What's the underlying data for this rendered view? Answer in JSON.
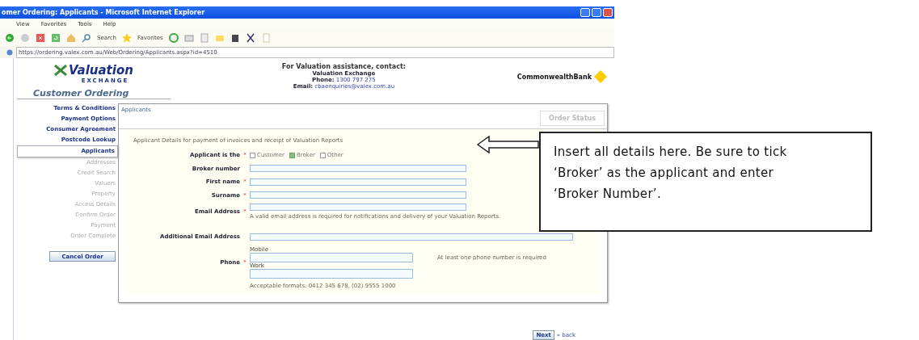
{
  "window": {
    "title": "omer Ordering: Applicants - Microsoft Internet Explorer"
  },
  "menu": [
    "View",
    "Favorites",
    "Tools",
    "Help"
  ],
  "toolbar": {
    "search": "Search",
    "favorites": "Favorites"
  },
  "address": {
    "value": "https://ordering.valex.com.au/Web/Ordering/Applicants.aspx?id=4510"
  },
  "header": {
    "logo": "Valuation",
    "logo_sub": "EXCHANGE",
    "app_title": "Customer Ordering",
    "contact_title": "For Valuation assistance, contact:",
    "contact_lines": [
      {
        "value": "Valuation Exchange"
      },
      {
        "label": "Phone:",
        "value": "1300 797 275"
      },
      {
        "label": "Email:",
        "value": "cbaenquiries@valex.com.au"
      }
    ],
    "bank": "CommonwealthBank"
  },
  "sidebar": {
    "items": [
      {
        "label": "Terms & Conditions",
        "selected": false,
        "disabled": false
      },
      {
        "label": "Payment Options",
        "selected": false,
        "disabled": false
      },
      {
        "label": "Consumer Agreement",
        "selected": false,
        "disabled": false
      },
      {
        "label": "Postcode Lookup",
        "selected": false,
        "disabled": false
      },
      {
        "label": "Applicants",
        "selected": true,
        "disabled": false
      },
      {
        "label": "Addresses",
        "selected": false,
        "disabled": true
      },
      {
        "label": "Credit Search",
        "selected": false,
        "disabled": true
      },
      {
        "label": "Valuers",
        "selected": false,
        "disabled": true
      },
      {
        "label": "Property",
        "selected": false,
        "disabled": true
      },
      {
        "label": "Access Details",
        "selected": false,
        "disabled": true
      },
      {
        "label": "Confirm Order",
        "selected": false,
        "disabled": true
      },
      {
        "label": "Payment",
        "selected": false,
        "disabled": true
      },
      {
        "label": "Order Complete",
        "selected": false,
        "disabled": true
      }
    ],
    "cancel_button": "Cancel Order"
  },
  "panel": {
    "title": "Applicants",
    "required_mark": "*",
    "order_status": "Order Status",
    "intro": "Applicant Details for payment of invoices and receipt of Valuation Reports",
    "applicant_type": {
      "label": "Applicant is the",
      "required": true,
      "options": [
        {
          "label": "Customer",
          "selected": false
        },
        {
          "label": "Broker",
          "selected": true
        },
        {
          "label": "Other",
          "selected": false
        }
      ]
    },
    "fields": [
      {
        "label": "Broker number",
        "required": false
      },
      {
        "label": "First name",
        "required": true
      },
      {
        "label": "Surname",
        "required": true
      }
    ],
    "email": {
      "label": "Email Address",
      "required": true,
      "note": "A valid email address is required for notifications and delivery of your Valuation Reports."
    },
    "additional_email": {
      "label": "Additional Email Address"
    },
    "phone": {
      "label": "Phone",
      "required": true,
      "sub": [
        "Mobile",
        "Work"
      ],
      "note": "At least one phone number is required",
      "formats": "Acceptable formats: 0412 345 678, (02) 9555 1000"
    }
  },
  "footer": {
    "next": "Next",
    "back": "« back"
  },
  "callout": {
    "lines": [
      "Insert all details here. Be sure to tick",
      "‘Broker’ as the applicant and enter",
      "‘Broker Number’."
    ]
  }
}
